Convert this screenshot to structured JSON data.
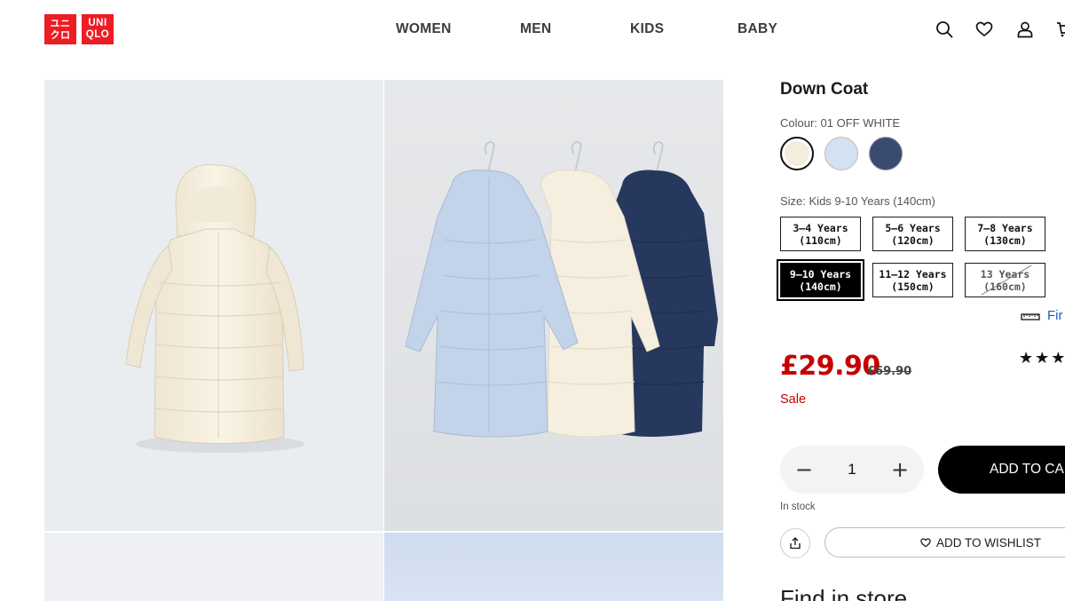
{
  "header": {
    "logo": {
      "top_left": "ユニ",
      "bottom_left": "クロ",
      "top_right": "UNI",
      "bottom_right": "QLO",
      "color": "#ed1d24"
    },
    "nav": [
      "WOMEN",
      "MEN",
      "KIDS",
      "BABY"
    ],
    "icons": [
      "search-icon",
      "heart-icon",
      "account-icon",
      "cart-icon"
    ]
  },
  "gallery": {
    "images": [
      "off-white-down-coat-front",
      "three-down-coats-on-hangers",
      "gallery-image-3",
      "gallery-image-4"
    ]
  },
  "product": {
    "title": "Down Coat",
    "colour_label": "Colour: 01 OFF WHITE",
    "colours": [
      {
        "name": "01 OFF WHITE",
        "hex": "#f4ecdc",
        "selected": true
      },
      {
        "name": "LIGHT BLUE",
        "hex": "#d4e1f1",
        "selected": false
      },
      {
        "name": "NAVY",
        "hex": "#3a4b72",
        "selected": false
      }
    ],
    "size_label": "Size: Kids 9-10 Years (140cm)",
    "sizes": [
      {
        "line1": "3–4 Years",
        "line2": "(110cm)",
        "selected": false,
        "unavailable": false
      },
      {
        "line1": "5–6 Years",
        "line2": "(120cm)",
        "selected": false,
        "unavailable": false
      },
      {
        "line1": "7–8 Years",
        "line2": "(130cm)",
        "selected": false,
        "unavailable": false
      },
      {
        "line1": "9–10 Years",
        "line2": "(140cm)",
        "selected": true,
        "unavailable": false
      },
      {
        "line1": "11–12 Years",
        "line2": "(150cm)",
        "selected": false,
        "unavailable": false
      },
      {
        "line1": "13 Years",
        "line2": "(160cm)",
        "selected": false,
        "unavailable": true
      }
    ],
    "size_guide": "Fir",
    "price": "£29.90",
    "old_price": "£69.90",
    "sale_label": "Sale",
    "rating_stars": "★★★",
    "price_color": "#c60000"
  },
  "purchase": {
    "quantity": "1",
    "minus": "−",
    "plus": "+",
    "add_to_cart": "ADD TO CAR",
    "stock_status": "In stock",
    "wishlist": "ADD TO WISHLIST"
  },
  "store": {
    "heading": "Find in store"
  }
}
